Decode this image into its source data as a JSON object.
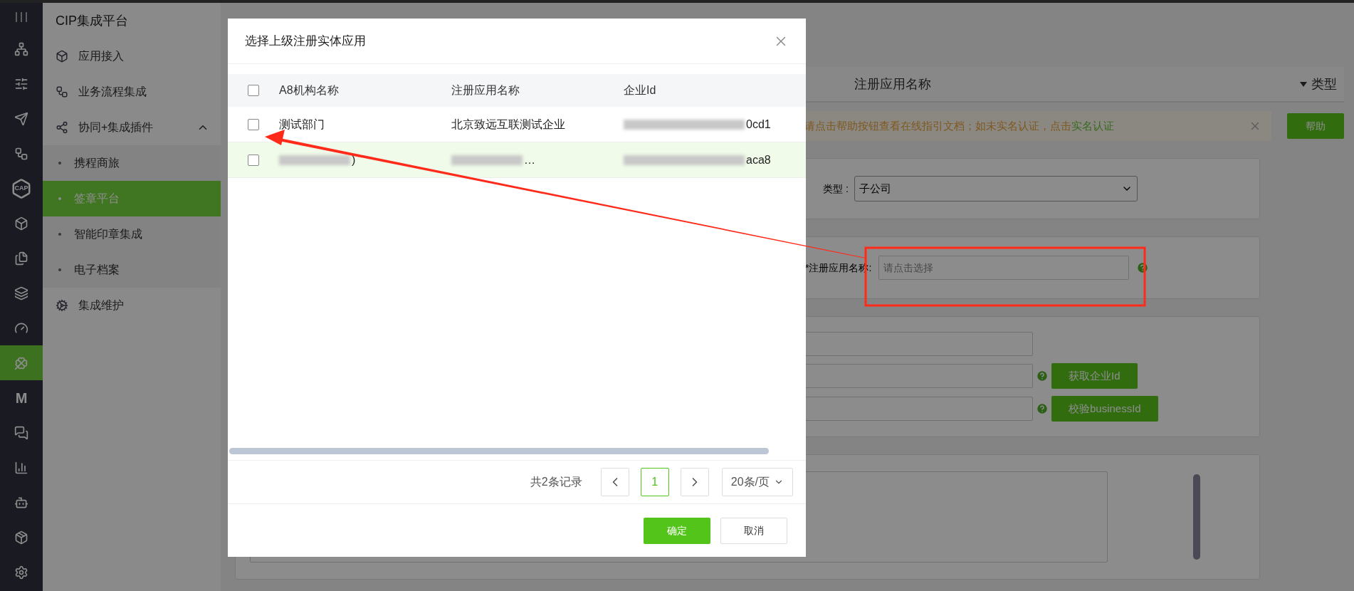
{
  "rail": {
    "items": [
      {
        "selected": false
      },
      {
        "selected": false
      },
      {
        "selected": false
      },
      {
        "selected": false
      },
      {
        "selected": false,
        "label": "CAP"
      },
      {
        "selected": false
      },
      {
        "selected": false
      },
      {
        "selected": false
      },
      {
        "selected": false
      },
      {
        "selected": true
      },
      {
        "selected": false,
        "label": "M"
      },
      {
        "selected": false
      },
      {
        "selected": false
      },
      {
        "selected": false
      },
      {
        "selected": false
      },
      {
        "selected": false
      }
    ]
  },
  "sidebar": {
    "title": "CIP集成平台",
    "items": [
      {
        "label": "应用接入"
      },
      {
        "label": "业务流程集成"
      },
      {
        "label": "协同+集成插件",
        "expanded": true,
        "children": [
          {
            "label": "携程商旅",
            "selected": false
          },
          {
            "label": "签章平台",
            "selected": true
          },
          {
            "label": "智能印章集成",
            "selected": false
          },
          {
            "label": "电子档案",
            "selected": false
          }
        ]
      },
      {
        "label": "集成维护"
      }
    ]
  },
  "background": {
    "table_header": {
      "column_1": "注册应用名称",
      "column_2": "类型"
    },
    "alert": {
      "text": "请点击帮助按钮查看在线指引文档；如未实名认证，点击",
      "link": "实名认证"
    },
    "help_button": "帮助",
    "type_field": {
      "label": "类型 :",
      "value": "子公司"
    },
    "app_name_field": {
      "label": "*注册应用名称:",
      "placeholder": "请点击选择"
    },
    "buttons": [
      "获取企业Id",
      "校验businessId"
    ]
  },
  "modal": {
    "title": "选择上级注册实体应用",
    "columns": [
      "A8机构名称",
      "注册应用名称",
      "企业Id"
    ],
    "all_checked": false,
    "rows": [
      {
        "checked": false,
        "hovered": false,
        "cells": [
          {
            "text": "测试部门",
            "redacted": false
          },
          {
            "text": "北京致远互联测试企业",
            "redacted": false
          },
          {
            "text": "0cd1",
            "redacted": true
          }
        ]
      },
      {
        "checked": false,
        "hovered": true,
        "cells": [
          {
            "text": ")",
            "redacted": true
          },
          {
            "text": "…",
            "redacted": true
          },
          {
            "text": "aca8",
            "redacted": true
          }
        ]
      }
    ],
    "pagination": {
      "total": "共2条记录",
      "pages": [
        {
          "label": "1",
          "selected": true
        }
      ],
      "page_size": "20条/页"
    },
    "buttons": [
      {
        "label": "确定",
        "kind": "primary"
      },
      {
        "label": "取消",
        "kind": "default"
      }
    ]
  }
}
